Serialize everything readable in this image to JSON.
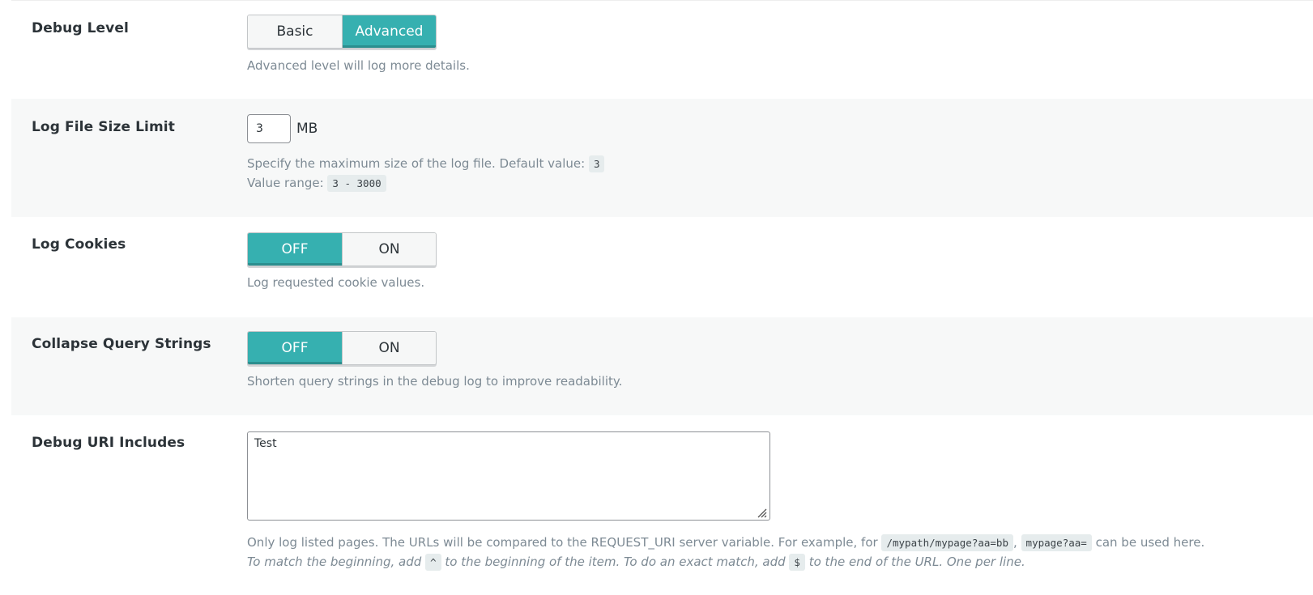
{
  "debug_level": {
    "label": "Debug Level",
    "options": [
      "Basic",
      "Advanced"
    ],
    "selected": "Advanced",
    "description": "Advanced level will log more details."
  },
  "log_file_size": {
    "label": "Log File Size Limit",
    "value": "3",
    "unit": "MB",
    "description": "Specify the maximum size of the log file. Default value:",
    "default_value": "3",
    "range_label": "Value range:",
    "range_value": "3 - 3000"
  },
  "log_cookies": {
    "label": "Log Cookies",
    "off_label": "OFF",
    "on_label": "ON",
    "selected": "OFF",
    "description": "Log requested cookie values."
  },
  "collapse_query": {
    "label": "Collapse Query Strings",
    "off_label": "OFF",
    "on_label": "ON",
    "selected": "OFF",
    "description": "Shorten query strings in the debug log to improve readability."
  },
  "debug_uri_includes": {
    "label": "Debug URI Includes",
    "value": "Test",
    "desc_line1_a": "Only log listed pages. The URLs will be compared to the REQUEST_URI server variable. For example, for",
    "example_1": "/mypath/mypage?aa=bb",
    "comma": ",",
    "example_2": "mypage?aa=",
    "desc_line1_b": "can be used here.",
    "desc_line2_a": "To match the beginning, add",
    "caret": "^",
    "desc_line2_b": "to the beginning of the item. To do an exact match, add",
    "dollar": "$",
    "desc_line2_c": "to the end of the URL. One per line."
  },
  "colors": {
    "accent": "#36b0b0",
    "row_alt_bg": "#f7f8f8",
    "description_text": "#7d8a94"
  },
  "icons": {
    "textarea_resize": "resize-grip-icon"
  }
}
